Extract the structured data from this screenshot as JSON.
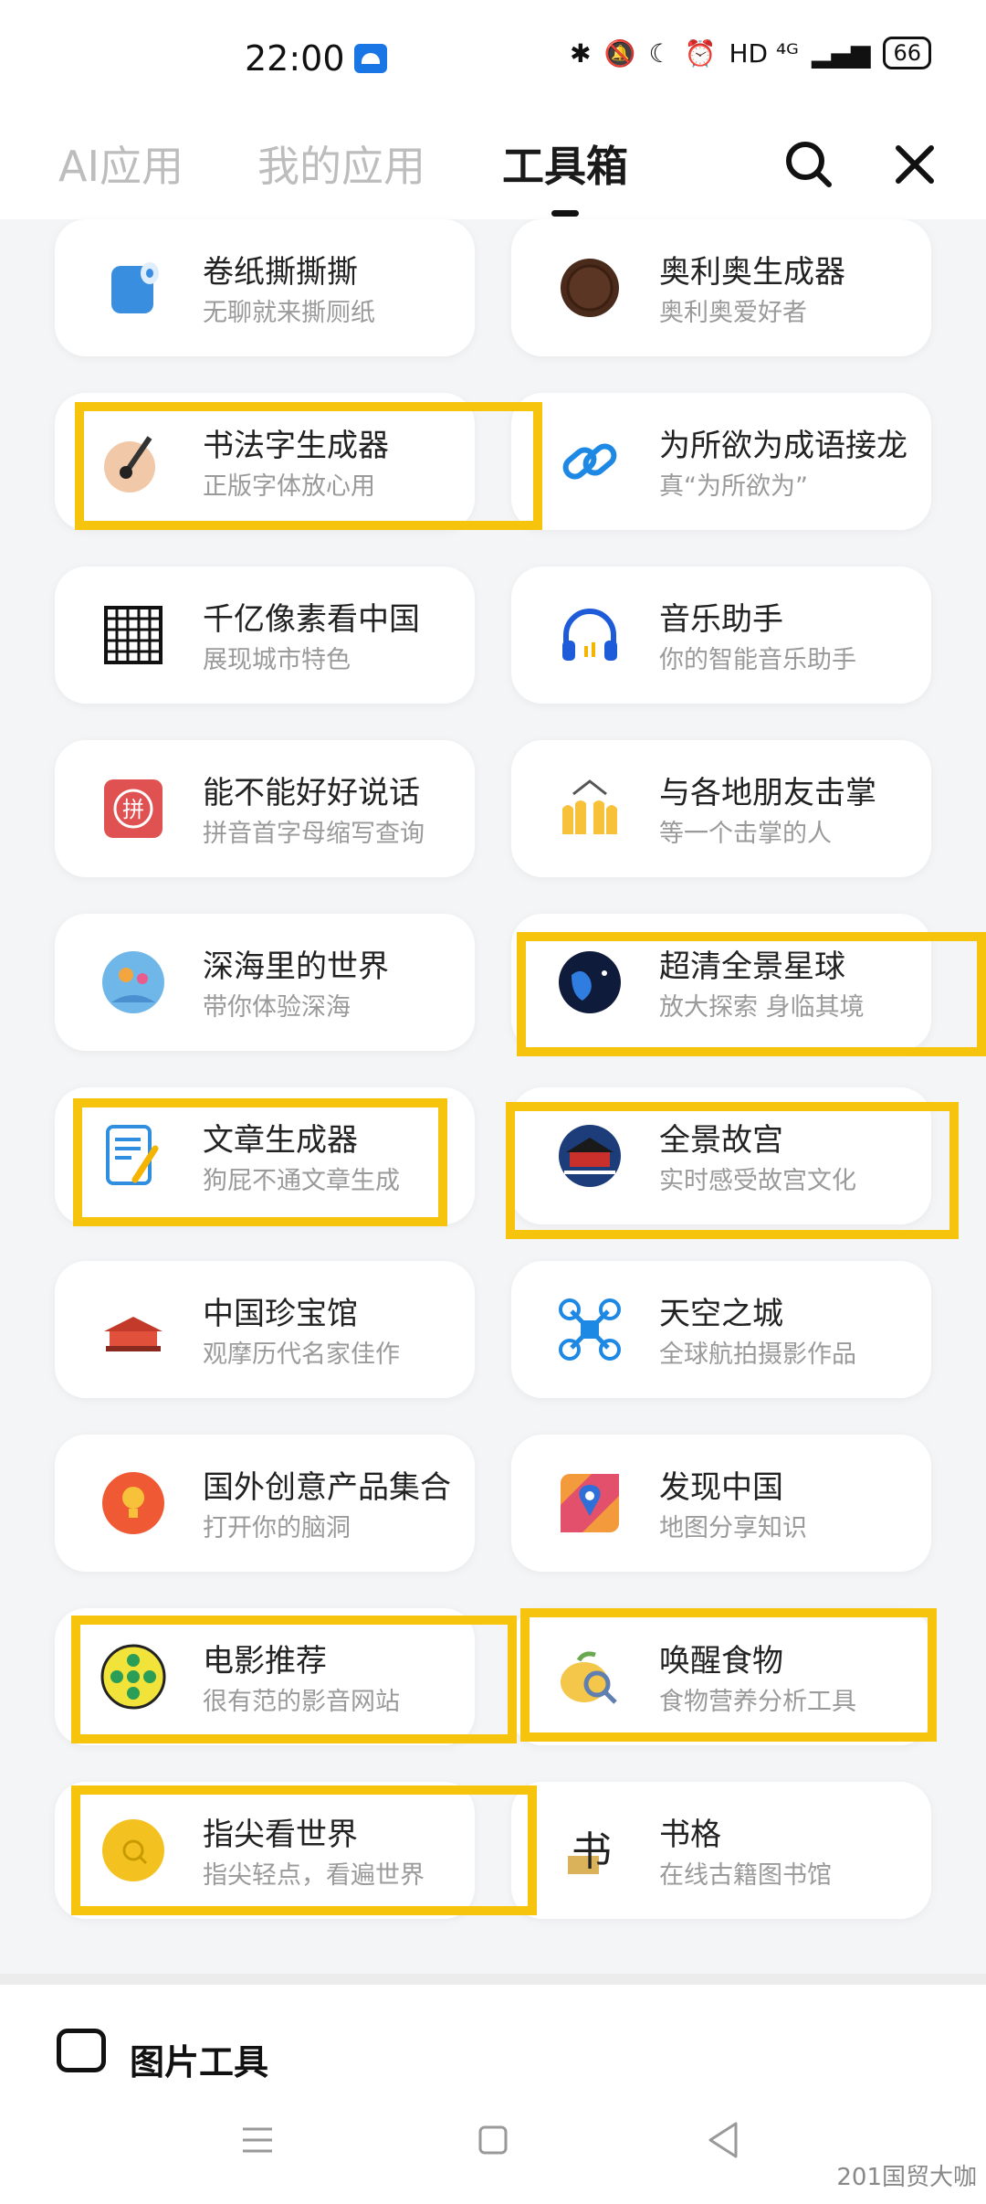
{
  "status_bar": {
    "time": "22:00",
    "network": "HD ⁴ᴳ",
    "battery": "66"
  },
  "tabs": [
    {
      "label": "AI应用",
      "active": false
    },
    {
      "label": "我的应用",
      "active": false
    },
    {
      "label": "工具箱",
      "active": true
    }
  ],
  "tools": [
    {
      "title": "卷纸撕撕撕",
      "subtitle": "无聊就来撕厕纸",
      "icon": "toilet-paper-icon"
    },
    {
      "title": "奥利奥生成器",
      "subtitle": "奥利奥爱好者",
      "icon": "oreo-icon"
    },
    {
      "title": "书法字生成器",
      "subtitle": "正版字体放心用",
      "icon": "calligraphy-brush-icon"
    },
    {
      "title": "为所欲为成语接龙",
      "subtitle": "真“为所欲为”",
      "icon": "chain-link-icon"
    },
    {
      "title": "千亿像素看中国",
      "subtitle": "展现城市特色",
      "icon": "pixel-grid-icon"
    },
    {
      "title": "音乐助手",
      "subtitle": "你的智能音乐助手",
      "icon": "headphones-icon"
    },
    {
      "title": "能不能好好说话",
      "subtitle": "拼音首字母缩写查询",
      "icon": "pinyin-seal-icon"
    },
    {
      "title": "与各地朋友击掌",
      "subtitle": "等一个击掌的人",
      "icon": "high-five-icon"
    },
    {
      "title": "深海里的世界",
      "subtitle": "带你体验深海",
      "icon": "deep-sea-icon"
    },
    {
      "title": "超清全景星球",
      "subtitle": "放大探索 身临其境",
      "icon": "planet-icon"
    },
    {
      "title": "文章生成器",
      "subtitle": "狗屁不通文章生成",
      "icon": "document-pen-icon"
    },
    {
      "title": "全景故宫",
      "subtitle": "实时感受故宫文化",
      "icon": "forbidden-city-icon"
    },
    {
      "title": "中国珍宝馆",
      "subtitle": "观摩历代名家佳作",
      "icon": "palace-icon"
    },
    {
      "title": "天空之城",
      "subtitle": "全球航拍摄影作品",
      "icon": "drone-icon"
    },
    {
      "title": "国外创意产品集合",
      "subtitle": "打开你的脑洞",
      "icon": "lightbulb-icon"
    },
    {
      "title": "发现中国",
      "subtitle": "地图分享知识",
      "icon": "map-pin-icon"
    },
    {
      "title": "电影推荐",
      "subtitle": "很有范的影音网站",
      "icon": "film-reel-icon"
    },
    {
      "title": "唤醒食物",
      "subtitle": "食物营养分析工具",
      "icon": "food-magnifier-icon"
    },
    {
      "title": "指尖看世界",
      "subtitle": "指尖轻点，看遍世界",
      "icon": "fingertip-icon"
    },
    {
      "title": "书格",
      "subtitle": "在线古籍图书馆",
      "icon": "ancient-book-icon"
    }
  ],
  "section": {
    "label": "图片工具"
  },
  "watermark": "201国贸大咖",
  "colors": {
    "highlight": "#f6c40c",
    "accent_blue": "#1976e4"
  }
}
